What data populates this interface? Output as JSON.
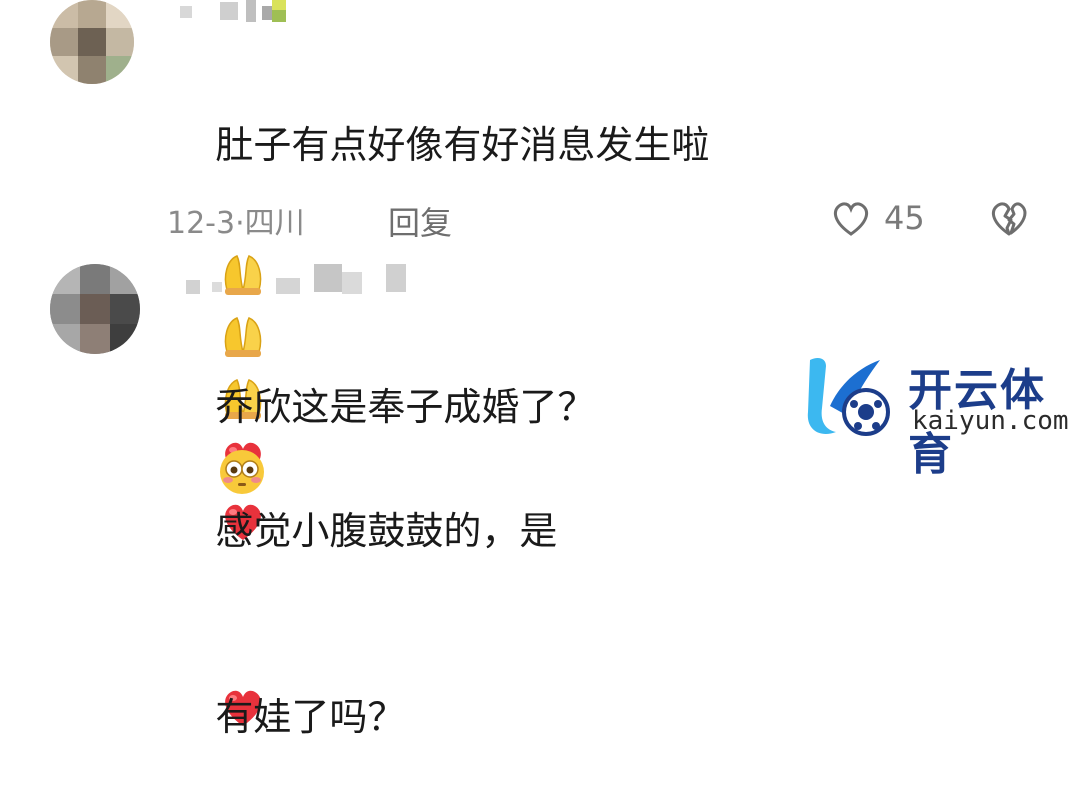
{
  "comments": [
    {
      "text_line1": "肚子有点好像有好消息发生啦",
      "text_line2": "",
      "date": "12-3",
      "location": "四川",
      "reply_label": "回复",
      "like_count": "45",
      "emojis": [
        "folded-hands",
        "folded-hands",
        "folded-hands",
        "red-heart",
        "red-heart",
        "red-heart"
      ]
    },
    {
      "text_part1": "乔欣这是奉子成婚了？",
      "text_part2": "感觉小腹鼓鼓的，是",
      "text_line2": "有娃了吗？",
      "emojis": [
        "flushed-face"
      ]
    }
  ],
  "watermark": {
    "brand": "开云体育",
    "url": "kaiyun.com"
  },
  "colors": {
    "heart": "#e8323c",
    "hands": "#f7c72d",
    "meta_gray": "#8a8a8a",
    "brand_blue": "#1c3d8a",
    "brand_cyan": "#3cb8f0"
  }
}
